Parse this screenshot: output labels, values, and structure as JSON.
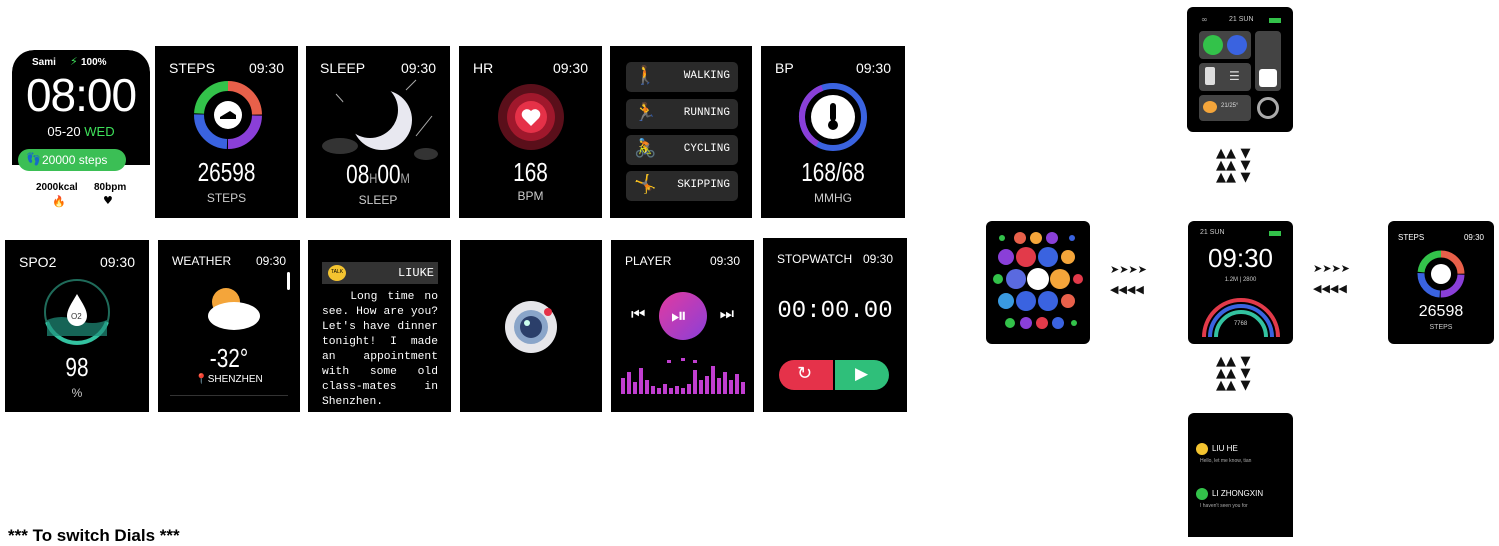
{
  "home": {
    "name": "Sami",
    "battery": "100%",
    "time": "08:00",
    "date": "05-20",
    "weekday": "WED",
    "steps": "20000 steps",
    "kcal": "2000kcal",
    "bpm": "80bpm"
  },
  "steps_screen": {
    "title": "STEPS",
    "time": "09:30",
    "value": "26598",
    "unit": "STEPS"
  },
  "sleep_screen": {
    "title": "SLEEP",
    "time": "09:30",
    "hours": "08",
    "h": "H",
    "minutes": "00",
    "m": "M",
    "unit": "SLEEP"
  },
  "hr_screen": {
    "title": "HR",
    "time": "09:30",
    "value": "168",
    "unit": "BPM"
  },
  "sports_screen": {
    "items": [
      {
        "label": "WALKING",
        "icon": "walking-icon"
      },
      {
        "label": "RUNNING",
        "icon": "running-icon"
      },
      {
        "label": "CYCLING",
        "icon": "cycling-icon"
      },
      {
        "label": "SKIPPING",
        "icon": "skipping-icon"
      }
    ]
  },
  "bp_screen": {
    "title": "BP",
    "time": "09:30",
    "value": "168/68",
    "unit": "MMHG"
  },
  "spo2_screen": {
    "title": "SPO2",
    "time": "09:30",
    "drop": "O2",
    "value": "98",
    "unit": "%"
  },
  "weather_screen": {
    "title": "WEATHER",
    "time": "09:30",
    "temp": "-32°",
    "city": "SHENZHEN"
  },
  "message_screen": {
    "badge": "TALK",
    "sender": "LIUKE",
    "body": "Long time no see. How are you? Let's have dinner tonight! I made an appointment with some old class-mates in Shenzhen."
  },
  "camera_screen": {
    "icon": "camera-icon"
  },
  "player_screen": {
    "title": "PLAYER",
    "time": "09:30"
  },
  "stopwatch_screen": {
    "title": "STOPWATCH",
    "time": "09:30",
    "value": "00:00.00"
  },
  "caption": "*** To switch Dials ***",
  "center_dial": {
    "date": "21 SUN",
    "time": "09:30",
    "steps": "1.2M",
    "kcal": "2800",
    "label": "7768"
  },
  "top_panel": {
    "date": "21 SUN",
    "weather": "21/25°"
  },
  "right_dial": {
    "title": "STEPS",
    "time": "09:30",
    "value": "26598",
    "unit": "STEPS"
  },
  "bottom_panel": {
    "messages": [
      {
        "name": "LIU HE",
        "text": "Hello, let me know, tian"
      },
      {
        "name": "LI ZHONGXIN",
        "text": "I haven't seen you for"
      }
    ]
  },
  "arrows": {
    "right": "➤➤➤➤",
    "left": "◀◀◀◀"
  },
  "colors": {
    "green": "#33c24a",
    "red": "#e23a4a",
    "purple": "#8a3fd8",
    "blue": "#3a63e0"
  }
}
